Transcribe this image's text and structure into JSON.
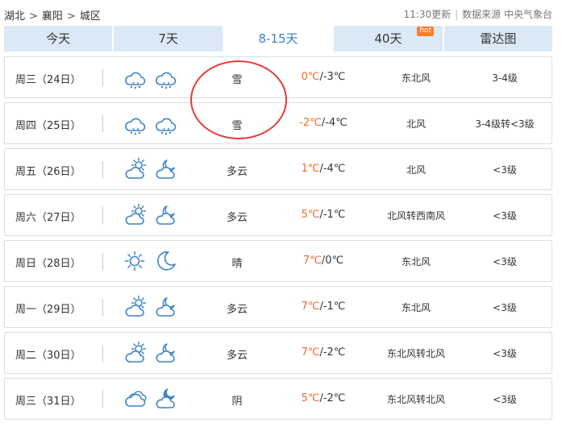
{
  "breadcrumb": [
    "湖北",
    "襄阳",
    "城区"
  ],
  "breadcrumb_sep": ">",
  "update": "11:30更新",
  "source": "数据来源 中央气象台",
  "tabs": [
    {
      "label": "今天"
    },
    {
      "label": "7天"
    },
    {
      "label": "8-15天"
    },
    {
      "label": "40天"
    },
    {
      "label": "雷达图"
    }
  ],
  "active_tab": "8-15天",
  "hot_badge": "hot",
  "temp_sep": "/",
  "colors": {
    "accent": "#3a83c8",
    "high_temp": "#ef6a2c",
    "tab_bg": "#dbe9f6",
    "annotation": "#e53b3b",
    "icon": "#3d84c6"
  },
  "days": [
    {
      "day": "周三（24日）",
      "icons": [
        "snow-cloud-icon",
        "snow-cloud-icon"
      ],
      "cond": "雪",
      "hi": "0℃",
      "lo": "-3℃",
      "wind": "东北风",
      "level": "3-4级"
    },
    {
      "day": "周四（25日）",
      "icons": [
        "snow-cloud-icon",
        "snow-cloud-icon"
      ],
      "cond": "雪",
      "hi": "-2℃",
      "lo": "-4℃",
      "wind": "北风",
      "level": "3-4级转<3级"
    },
    {
      "day": "周五（26日）",
      "icons": [
        "partly-cloudy-day-icon",
        "partly-cloudy-night-icon"
      ],
      "cond": "多云",
      "hi": "1℃",
      "lo": "-4℃",
      "wind": "北风",
      "level": "<3级"
    },
    {
      "day": "周六（27日）",
      "icons": [
        "partly-cloudy-day-icon",
        "partly-cloudy-night-icon"
      ],
      "cond": "多云",
      "hi": "5℃",
      "lo": "-1℃",
      "wind": "北风转西南风",
      "level": "<3级"
    },
    {
      "day": "周日（28日）",
      "icons": [
        "sun-icon",
        "moon-icon"
      ],
      "cond": "晴",
      "hi": "7℃",
      "lo": "0℃",
      "wind": "东北风",
      "level": "<3级"
    },
    {
      "day": "周一（29日）",
      "icons": [
        "partly-cloudy-day-icon",
        "partly-cloudy-night-icon"
      ],
      "cond": "多云",
      "hi": "7℃",
      "lo": "-1℃",
      "wind": "东北风",
      "level": "<3级"
    },
    {
      "day": "周二（30日）",
      "icons": [
        "partly-cloudy-day-icon",
        "partly-cloudy-night-icon"
      ],
      "cond": "多云",
      "hi": "7℃",
      "lo": "-2℃",
      "wind": "东北风转北风",
      "level": "<3级"
    },
    {
      "day": "周三（31日）",
      "icons": [
        "overcast-icon",
        "cloudy-night-icon"
      ],
      "cond": "阴",
      "hi": "5℃",
      "lo": "-2℃",
      "wind": "东北风转北风",
      "level": "<3级"
    }
  ]
}
